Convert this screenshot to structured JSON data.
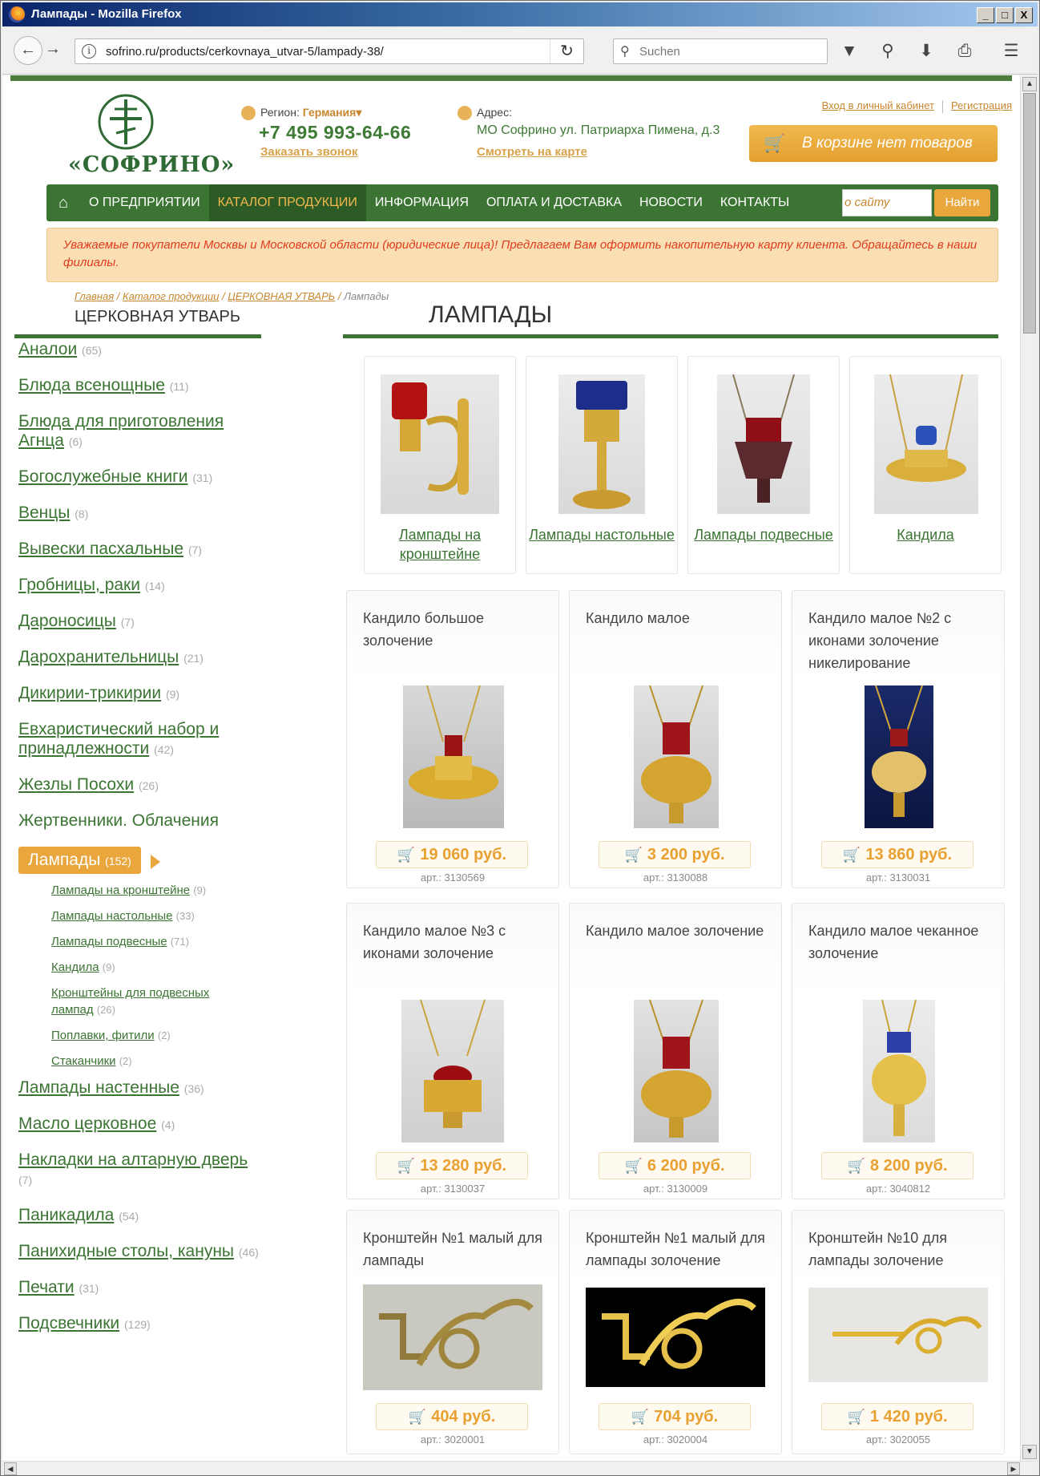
{
  "browser": {
    "window_title": "Лампады - Mozilla Firefox",
    "url": "sofrino.ru/products/cerkovnaya_utvar-5/lampady-38/",
    "search_placeholder": "Suchen",
    "win_min": "_",
    "win_max": "□",
    "win_close": "X"
  },
  "header": {
    "logo_text": "«СОФРИНО»",
    "region_label": "Регион:",
    "region_value": "Германия",
    "phone": "+7 495 993-64-66",
    "callback": "Заказать звонок",
    "address_label": "Адрес:",
    "address": "МО Софрино ул. Патриарха Пимена, д.3",
    "map_link": "Смотреть на карте",
    "login": "Вход в личный кабинет",
    "register": "Регистрация",
    "cart": "В корзине нет товаров"
  },
  "nav": {
    "items": [
      "О ПРЕДПРИЯТИИ",
      "КАТАЛОГ ПРОДУКЦИИ",
      "ИНФОРМАЦИЯ",
      "ОПЛАТА И ДОСТАВКА",
      "НОВОСТИ",
      "КОНТАКТЫ"
    ],
    "search_value": "о сайту",
    "search_button": "Найти"
  },
  "notice": "Уважаемые покупатели Москвы и Московской области (юридические лица)!  Предлагаем Вам оформить накопительную карту клиента. Обращайтесь в наши филиалы.",
  "breadcrumbs": [
    "Главная",
    "Каталог продукции",
    "ЦЕРКОВНАЯ УТВАРЬ",
    "Лампады"
  ],
  "sidebar": {
    "title": "ЦЕРКОВНАЯ УТВАРЬ",
    "categories": [
      {
        "label": "Аналои",
        "count": "(65)"
      },
      {
        "label": "Блюда всенощные",
        "count": "(11)"
      },
      {
        "label": "Блюда для приготовления Агнца",
        "count": "(6)"
      },
      {
        "label": "Богослужебные книги",
        "count": "(31)"
      },
      {
        "label": "Венцы",
        "count": "(8)"
      },
      {
        "label": "Вывески пасхальные",
        "count": "(7)"
      },
      {
        "label": "Гробницы, раки",
        "count": "(14)"
      },
      {
        "label": "Дароносицы",
        "count": "(7)"
      },
      {
        "label": "Дарохранительницы",
        "count": "(21)"
      },
      {
        "label": "Дикирии-трикирии",
        "count": "(9)"
      },
      {
        "label": "Евхаристический набор и принадлежности",
        "count": "(42)"
      },
      {
        "label": "Жезлы Посохи",
        "count": "(26)"
      },
      {
        "label": "Жертвенники. Облачения",
        "count": ""
      }
    ],
    "active": {
      "label": "Лампады",
      "count": "(152)"
    },
    "subitems": [
      {
        "label": "Лампады на кронштейне",
        "count": "(9)"
      },
      {
        "label": "Лампады настольные",
        "count": "(33)"
      },
      {
        "label": "Лампады подвесные",
        "count": "(71)"
      },
      {
        "label": "Кандила",
        "count": "(9)"
      },
      {
        "label": "Кронштейны для подвесных лампад",
        "count": "(26)"
      },
      {
        "label": "Поплавки, фитили",
        "count": "(2)"
      },
      {
        "label": "Стаканчики",
        "count": "(2)"
      }
    ],
    "categories_after": [
      {
        "label": "Лампады настенные",
        "count": "(36)"
      },
      {
        "label": "Масло церковное",
        "count": "(4)"
      },
      {
        "label": "Накладки на алтарную дверь",
        "count": "(7)"
      },
      {
        "label": "Паникадила",
        "count": "(54)"
      },
      {
        "label": "Панихидные столы, кануны",
        "count": "(46)"
      },
      {
        "label": "Печати",
        "count": "(31)"
      },
      {
        "label": "Подсвечники",
        "count": "(129)"
      }
    ]
  },
  "main": {
    "title": "ЛАМПАДЫ",
    "subcategories": [
      "Лампады на кронштейне",
      "Лампады настольные",
      "Лампады подвесные",
      "Кандила"
    ],
    "products": [
      {
        "name": "Кандило большое золочение",
        "price": "19 060 руб.",
        "article": "арт.: 3130569"
      },
      {
        "name": "Кандило малое",
        "price": "3 200 руб.",
        "article": "арт.: 3130088"
      },
      {
        "name": "Кандило малое №2 с иконами золочение никелирование",
        "price": "13 860 руб.",
        "article": "арт.: 3130031"
      },
      {
        "name": "Кандило малое №3 с иконами золочение",
        "price": "13 280 руб.",
        "article": "арт.: 3130037"
      },
      {
        "name": "Кандило малое золочение",
        "price": "6 200 руб.",
        "article": "арт.: 3130009"
      },
      {
        "name": "Кандило малое чеканное золочение",
        "price": "8 200 руб.",
        "article": "арт.: 3040812"
      },
      {
        "name": "Кронштейн №1 малый для лампады",
        "price": "404 руб.",
        "article": "арт.: 3020001"
      },
      {
        "name": "Кронштейн №1 малый для лампады золочение",
        "price": "704 руб.",
        "article": "арт.: 3020004"
      },
      {
        "name": "Кронштейн №10 для лампады золочение",
        "price": "1 420 руб.",
        "article": "арт.: 3020055"
      }
    ]
  },
  "icons": {
    "back": "arrow-left-icon",
    "forward": "arrow-right-icon",
    "reload": "reload-icon",
    "search": "search-icon",
    "pocket": "pocket-icon",
    "download": "download-icon",
    "print": "print-icon",
    "menu": "hamburger-icon",
    "home": "home-icon",
    "cart": "cart-icon"
  },
  "colors": {
    "green": "#3b7433",
    "orange": "#e8a63c",
    "notice_bg": "#f9dfb3",
    "notice_text": "#e03c1f"
  }
}
